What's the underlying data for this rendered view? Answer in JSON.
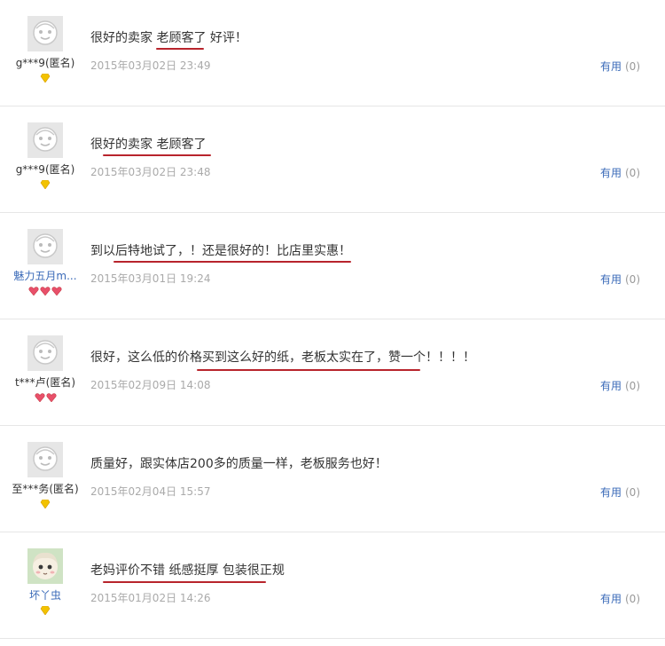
{
  "reviews": [
    {
      "nick": "g***9(匿名)",
      "nick_color": "#333333",
      "avatar": "default",
      "rank": "diamond-1",
      "content": "很好的卖家 老顾客了 好评！",
      "date": "2015年03月02日 23:49",
      "useful_label": "有用",
      "useful_count": "(0)"
    },
    {
      "nick": "g***9(匿名)",
      "nick_color": "#333333",
      "avatar": "default",
      "rank": "diamond-1",
      "content": "很好的卖家 老顾客了",
      "date": "2015年03月02日 23:48",
      "useful_label": "有用",
      "useful_count": "(0)"
    },
    {
      "nick": "魅力五月m...",
      "nick_color": "#3a6ab8",
      "avatar": "default",
      "rank": "heart-3",
      "content": "到以后特地试了，！还是很好的！比店里实惠！",
      "date": "2015年03月01日 19:24",
      "useful_label": "有用",
      "useful_count": "(0)"
    },
    {
      "nick": "t***卢(匿名)",
      "nick_color": "#333333",
      "avatar": "default",
      "rank": "heart-2",
      "content": "很好，这么低的价格买到这么好的纸，老板太实在了，赞一个！！！！",
      "date": "2015年02月09日 14:08",
      "useful_label": "有用",
      "useful_count": "(0)"
    },
    {
      "nick": "至***务(匿名)",
      "nick_color": "#333333",
      "avatar": "default",
      "rank": "diamond-1",
      "content": "质量好，跟实体店200多的质量一样，老板服务也好！",
      "date": "2015年02月04日 15:57",
      "useful_label": "有用",
      "useful_count": "(0)"
    },
    {
      "nick": "坏丫虫",
      "nick_color": "#3a6ab8",
      "avatar": "photo",
      "rank": "diamond-1",
      "content": "老妈评价不错 纸感挺厚 包装很正规",
      "date": "2015年01月02日 14:26",
      "useful_label": "有用",
      "useful_count": "(0)"
    }
  ],
  "colors": {
    "underline": "#b8242c",
    "link": "#3a6ab8",
    "date": "#aaaaaa"
  }
}
